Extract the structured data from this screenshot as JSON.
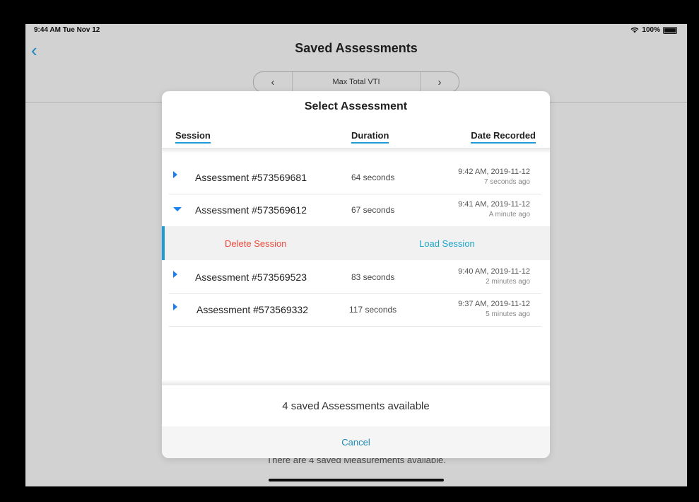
{
  "status_bar": {
    "time": "9:44 AM  Tue Nov 12",
    "battery": "100%"
  },
  "nav": {
    "back_icon": "‹",
    "title": "Saved Assessments"
  },
  "segmented": {
    "prev": "‹",
    "label": "Max Total VTI",
    "next": "›"
  },
  "background_footer": "There are 4 saved Measurements available.",
  "modal": {
    "title": "Select Assessment",
    "columns": {
      "session": "Session",
      "duration": "Duration",
      "date": "Date Recorded"
    },
    "rows": [
      {
        "name": "Assessment #573569681",
        "duration": "64 seconds",
        "date": "9:42 AM, 2019-11-12",
        "ago": "7 seconds ago",
        "expanded": false
      },
      {
        "name": "Assessment #573569612",
        "duration": "67 seconds",
        "date": "9:41 AM, 2019-11-12",
        "ago": "A minute ago",
        "expanded": true
      },
      {
        "name": "Assessment #573569523",
        "duration": "83 seconds",
        "date": "9:40 AM, 2019-11-12",
        "ago": "2 minutes ago",
        "expanded": false
      },
      {
        "name": "Assessment #573569332",
        "duration": "117 seconds",
        "date": "9:37 AM, 2019-11-12",
        "ago": "5 minutes ago",
        "expanded": false
      }
    ],
    "actions": {
      "delete": "Delete Session",
      "load": "Load Session"
    },
    "count_text": "4 saved Assessments available",
    "cancel": "Cancel"
  },
  "colors": {
    "accent": "#1e9bd7",
    "delete": "#e84b3c",
    "arrow": "#1e7ef0"
  }
}
